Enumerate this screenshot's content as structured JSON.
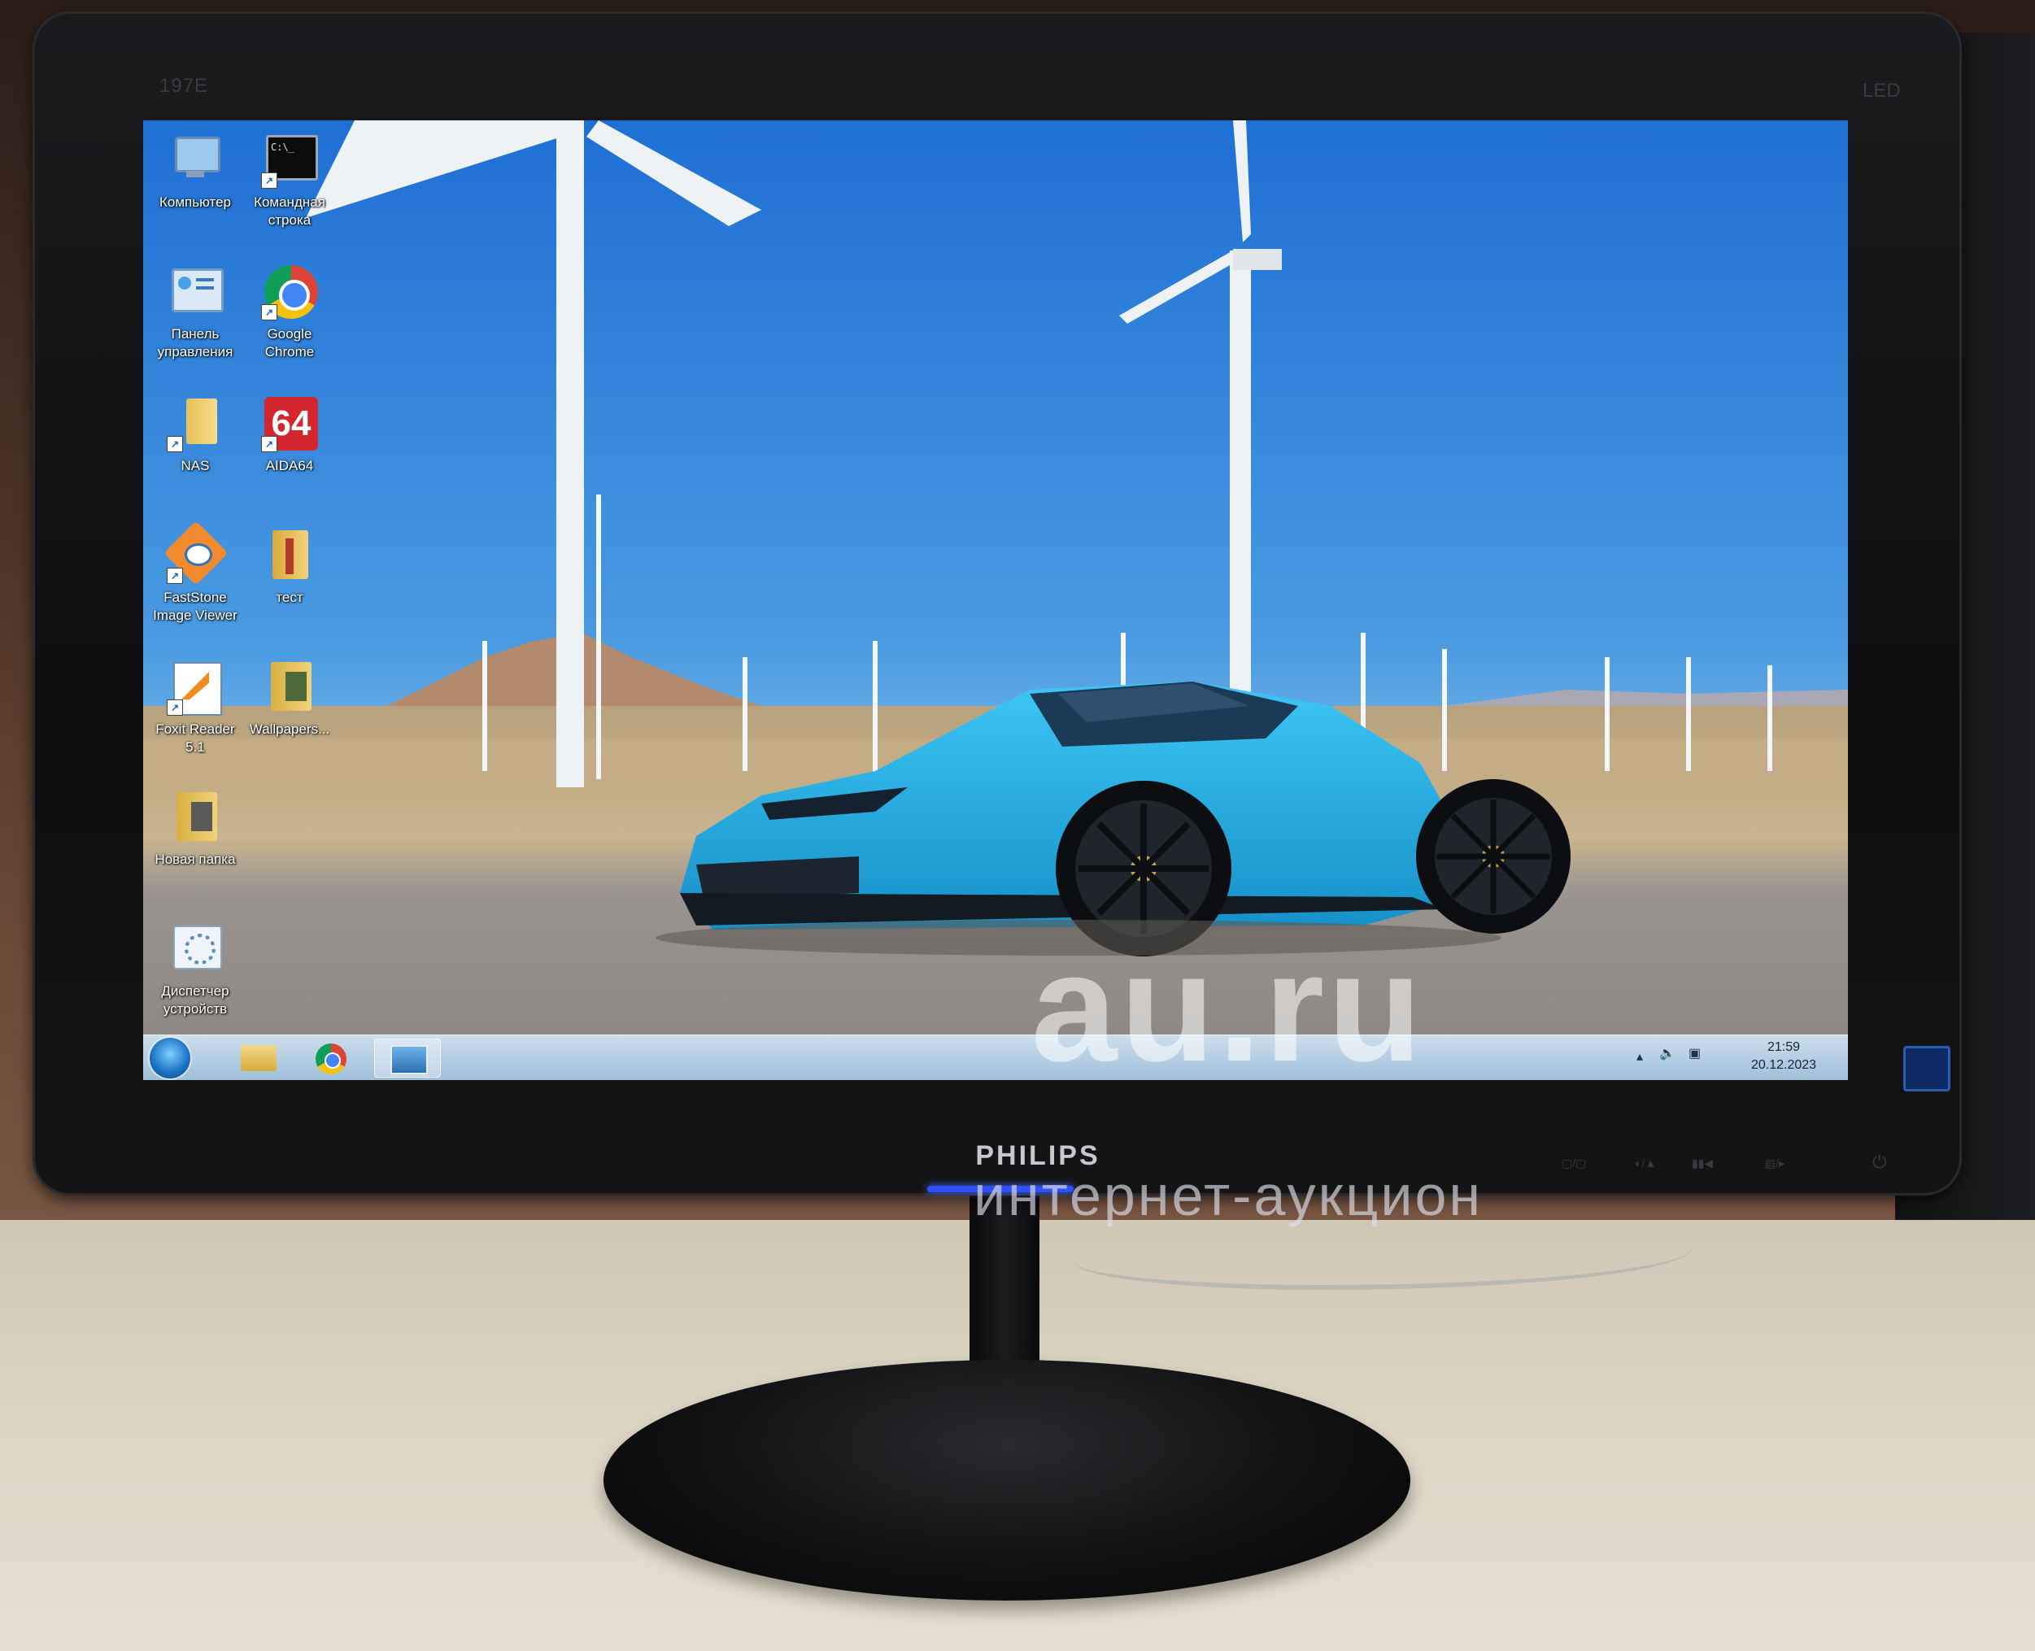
{
  "monitor": {
    "model_label": "197E",
    "led_label": "LED",
    "brand": "PHILIPS"
  },
  "desktop": {
    "icons": [
      {
        "label": "Компьютер",
        "icon": "computer-icon"
      },
      {
        "label": "Командная\nстрока",
        "icon": "command-prompt-icon"
      },
      {
        "label": "Панель\nуправления",
        "icon": "control-panel-icon"
      },
      {
        "label": "Google\nChrome",
        "icon": "chrome-icon"
      },
      {
        "label": "NAS",
        "icon": "folder-icon"
      },
      {
        "label": "AIDA64",
        "icon": "aida64-icon",
        "badge": "64"
      },
      {
        "label": "FastStone\nImage Viewer",
        "icon": "faststone-icon"
      },
      {
        "label": "тест",
        "icon": "folder-icon"
      },
      {
        "label": "Foxit Reader\n5.1",
        "icon": "foxit-reader-icon"
      },
      {
        "label": "Wallpapers...",
        "icon": "folder-icon"
      },
      {
        "label": "Новая папка",
        "icon": "folder-icon"
      },
      {
        "label": "Диспетчер\nустройств",
        "icon": "device-manager-icon"
      }
    ]
  },
  "taskbar": {
    "pinned": [
      {
        "name": "start-button",
        "icon": "windows-orb-icon"
      },
      {
        "name": "explorer",
        "icon": "folder-icon"
      },
      {
        "name": "chrome",
        "icon": "chrome-icon"
      },
      {
        "name": "faststone",
        "icon": "image-viewer-icon"
      }
    ],
    "tray_icons": [
      "show-hidden-arrow-icon",
      "volume-icon",
      "network-icon"
    ],
    "time": "21:59",
    "date": "20.12.2023"
  },
  "watermark": {
    "big": "au.ru",
    "small": "интернет-аукцион"
  },
  "colors": {
    "sky_top": "#1f74d6",
    "sky_bottom": "#8cc3ea",
    "car": "#27b3e8",
    "bezel": "#111113",
    "taskbar": "#b6d3ea"
  }
}
